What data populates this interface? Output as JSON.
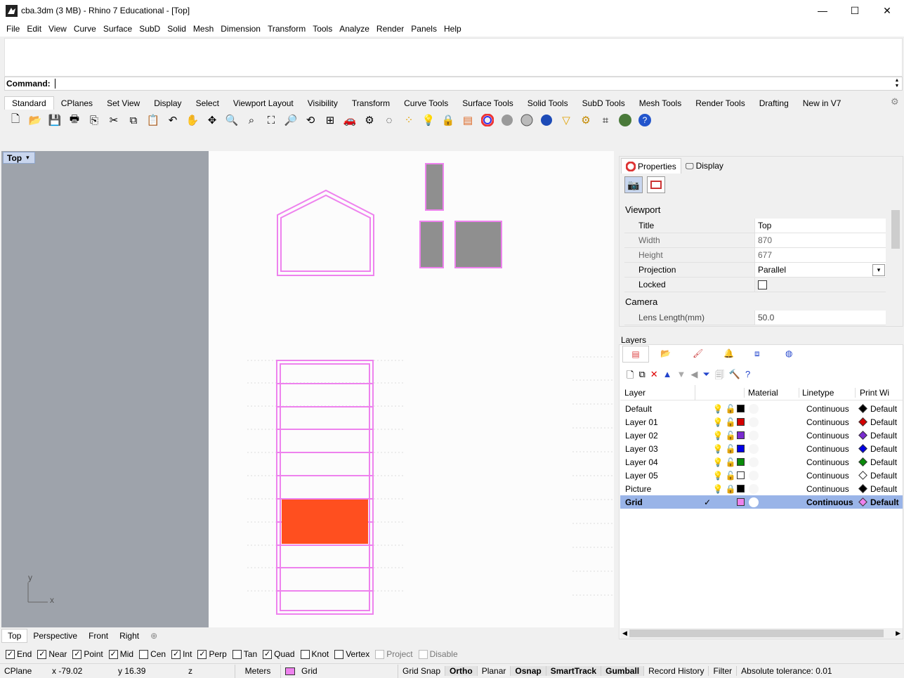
{
  "window": {
    "title": "cba.3dm (3 MB) - Rhino 7 Educational - [Top]",
    "minimize": "—",
    "maximize": "☐",
    "close": "✕"
  },
  "menu": [
    "File",
    "Edit",
    "View",
    "Curve",
    "Surface",
    "SubD",
    "Solid",
    "Mesh",
    "Dimension",
    "Transform",
    "Tools",
    "Analyze",
    "Render",
    "Panels",
    "Help"
  ],
  "command": {
    "label": "Command:",
    "value": ""
  },
  "toolbar_tabs": [
    "Standard",
    "CPlanes",
    "Set View",
    "Display",
    "Select",
    "Viewport Layout",
    "Visibility",
    "Transform",
    "Curve Tools",
    "Surface Tools",
    "Solid Tools",
    "SubD Tools",
    "Mesh Tools",
    "Render Tools",
    "Drafting",
    "New in V7"
  ],
  "toolbar_icons": [
    "new-icon",
    "open-icon",
    "save-icon",
    "print-icon",
    "import-icon",
    "cut-icon",
    "copy-icon",
    "paste-icon",
    "undo-icon",
    "pan-icon",
    "rotate-view-icon",
    "zoom-in-icon",
    "zoom-window-icon",
    "zoom-extents-icon",
    "zoom-selected-icon",
    "rotate-icon",
    "four-viewports-icon",
    "car-icon",
    "options-icon",
    "circle-icon",
    "points-icon",
    "light-icon",
    "lock-icon",
    "layer-icon",
    "color-wheel-icon",
    "shaded-sphere-icon",
    "rendered-sphere-icon",
    "blue-sphere-icon",
    "render-cone-icon",
    "gear-icon",
    "snapshot-icon",
    "globe-icon",
    "help-icon"
  ],
  "viewport": {
    "label": "Top",
    "axis_y": "y",
    "axis_x": "x",
    "tabs": [
      "Top",
      "Perspective",
      "Front",
      "Right"
    ],
    "add_tab": "⊕"
  },
  "properties": {
    "tab_properties": "Properties",
    "tab_display": "Display",
    "section_viewport": "Viewport",
    "section_camera": "Camera",
    "rows": [
      {
        "key": "Title",
        "value": "Top"
      },
      {
        "key": "Width",
        "value": "870"
      },
      {
        "key": "Height",
        "value": "677"
      },
      {
        "key": "Projection",
        "value": "Parallel"
      },
      {
        "key": "Locked",
        "value": ""
      }
    ],
    "lens_key": "Lens Length(mm)",
    "lens_value": "50.0"
  },
  "layers": {
    "title": "Layers",
    "headers": {
      "layer": "Layer",
      "material": "Material",
      "linetype": "Linetype",
      "print": "Print Wi"
    },
    "rows": [
      {
        "name": "Default",
        "color": "#000000",
        "linetype": "Continuous",
        "print": "Default",
        "pcolor": "#000000",
        "current": ""
      },
      {
        "name": "Layer 01",
        "color": "#d40000",
        "linetype": "Continuous",
        "print": "Default",
        "pcolor": "#d40000",
        "current": ""
      },
      {
        "name": "Layer 02",
        "color": "#7a2bd0",
        "linetype": "Continuous",
        "print": "Default",
        "pcolor": "#7a2bd0",
        "current": ""
      },
      {
        "name": "Layer 03",
        "color": "#0000e6",
        "linetype": "Continuous",
        "print": "Default",
        "pcolor": "#0000e6",
        "current": ""
      },
      {
        "name": "Layer 04",
        "color": "#0a8a0a",
        "linetype": "Continuous",
        "print": "Default",
        "pcolor": "#0a8a0a",
        "current": ""
      },
      {
        "name": "Layer 05",
        "color": "#ffffff",
        "linetype": "Continuous",
        "print": "Default",
        "pcolor": "#ffffff",
        "current": ""
      },
      {
        "name": "Picture",
        "color": "#000000",
        "linetype": "Continuous",
        "print": "Default",
        "pcolor": "#000000",
        "current": ""
      },
      {
        "name": "Grid",
        "color": "#ee82ee",
        "linetype": "Continuous",
        "print": "Default",
        "pcolor": "#ee82ee",
        "current": "✓"
      }
    ]
  },
  "osnaps": [
    {
      "label": "End",
      "checked": true
    },
    {
      "label": "Near",
      "checked": true
    },
    {
      "label": "Point",
      "checked": true
    },
    {
      "label": "Mid",
      "checked": true
    },
    {
      "label": "Cen",
      "checked": false
    },
    {
      "label": "Int",
      "checked": true
    },
    {
      "label": "Perp",
      "checked": true
    },
    {
      "label": "Tan",
      "checked": false
    },
    {
      "label": "Quad",
      "checked": true
    },
    {
      "label": "Knot",
      "checked": false
    },
    {
      "label": "Vertex",
      "checked": false
    },
    {
      "label": "Project",
      "checked": false,
      "disabled": true
    },
    {
      "label": "Disable",
      "checked": false,
      "disabled": true
    }
  ],
  "status": {
    "cplane": "CPlane",
    "x": "x -79.02",
    "y": "y 16.39",
    "z": "z",
    "units": "Meters",
    "layer": "Grid",
    "layer_color": "#ee82ee",
    "toggles": [
      "Grid Snap",
      "Ortho",
      "Planar",
      "Osnap",
      "SmartTrack",
      "Gumball",
      "Record History",
      "Filter"
    ],
    "bold_toggles": [
      "Ortho",
      "Osnap",
      "SmartTrack",
      "Gumball"
    ],
    "tolerance": "Absolute tolerance: 0.01"
  },
  "colors": {
    "accent": "#99b4e8",
    "grid_magenta": "#ee82ee",
    "highlight_fill": "#ff4f1f",
    "viewport_gray": "#9ea3ab"
  }
}
